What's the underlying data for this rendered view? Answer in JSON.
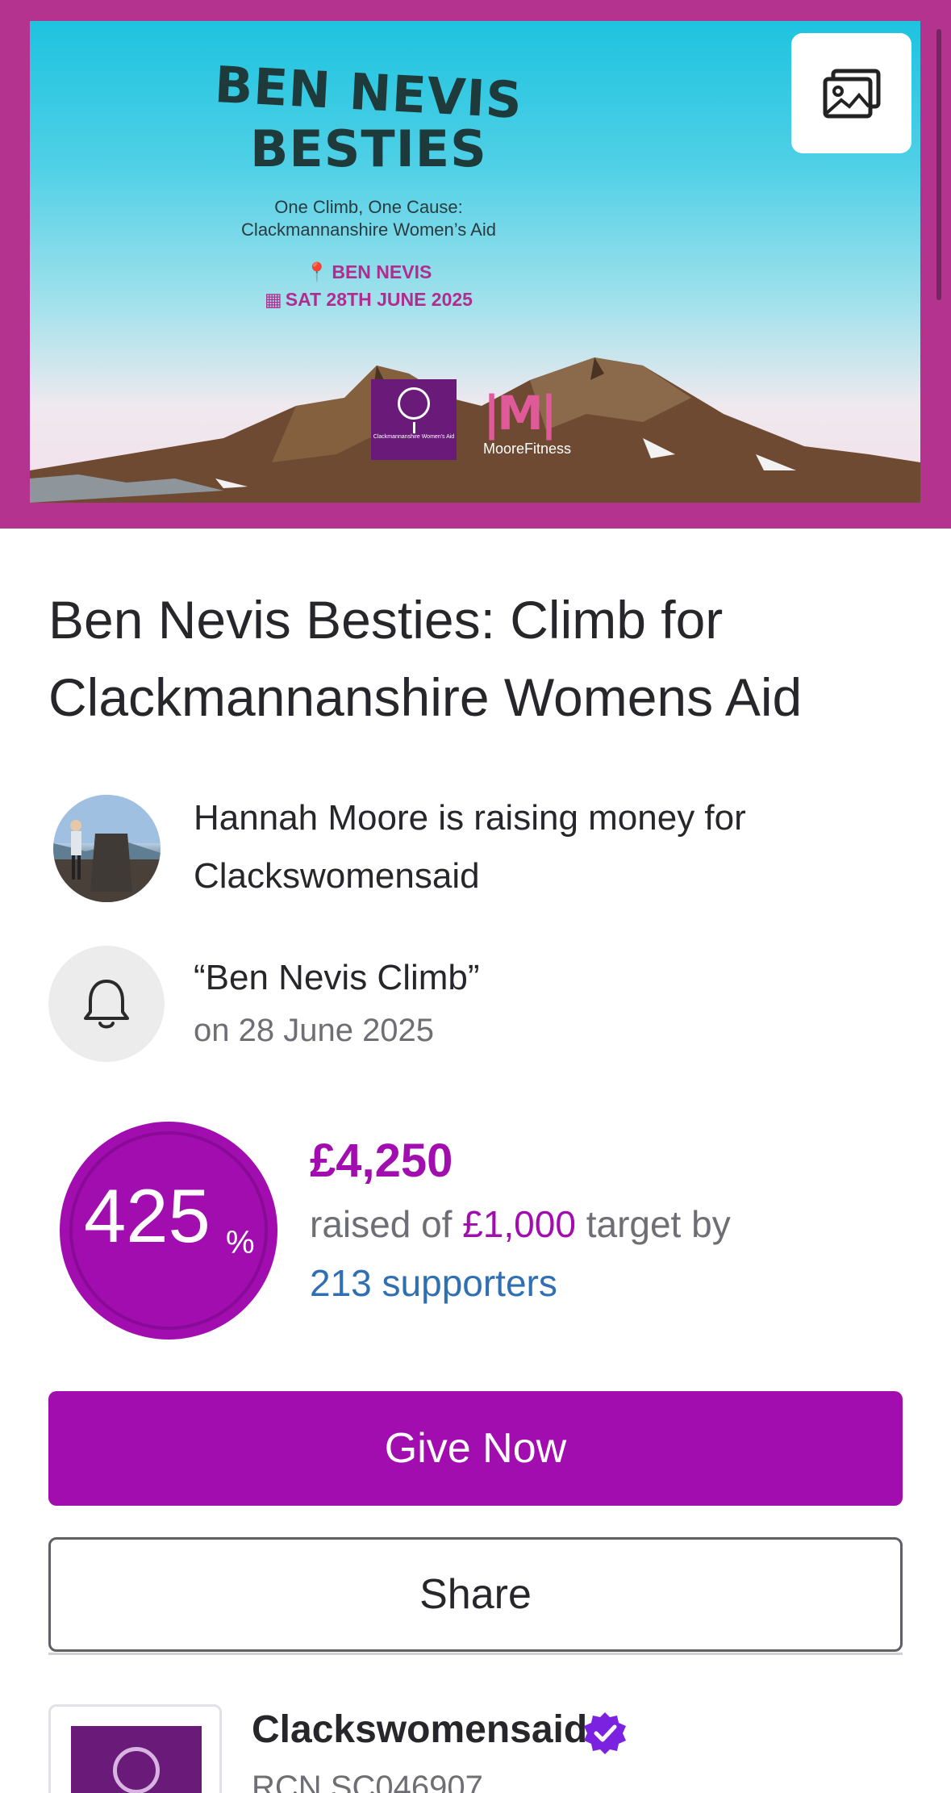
{
  "hero": {
    "poster_title_line1": "BEN NEVIS",
    "poster_title_line2": "BESTIES",
    "poster_sub_line1": "One Climb,  One Cause:",
    "poster_sub_line2": "Clackmannanshire Women’s Aid",
    "poster_location": "BEN NEVIS",
    "poster_date": "SAT 28TH JUNE 2025",
    "logo_small_text": "Clackmannanshire Women's Aid",
    "sponsor_text": "MooreFitness",
    "gallery_icon": "image-gallery-icon",
    "border_color": "#b3338f"
  },
  "page": {
    "title": "Ben Nevis Besties: Climb for Clackmannanshire Womens Aid"
  },
  "fundraiser": {
    "line1": "Hannah Moore is raising money for",
    "line2": "Clackswomensaid"
  },
  "event": {
    "icon": "bell-icon",
    "name": "“Ben Nevis Climb”",
    "date": "on 28 June 2025"
  },
  "progress": {
    "percent": "425",
    "percent_unit": "%",
    "amount_raised": "£4,250",
    "raised_prefix": "raised of ",
    "target": "£1,000",
    "raised_suffix": " target by",
    "supporters": "213 supporters",
    "accent_color": "#a20db0",
    "link_color": "#2f6fb2"
  },
  "actions": {
    "give_label": "Give Now",
    "share_label": "Share"
  },
  "charity": {
    "name": "Clackswomensaid",
    "registration": "RCN SC046907",
    "verified_icon": "verified-badge-icon"
  }
}
